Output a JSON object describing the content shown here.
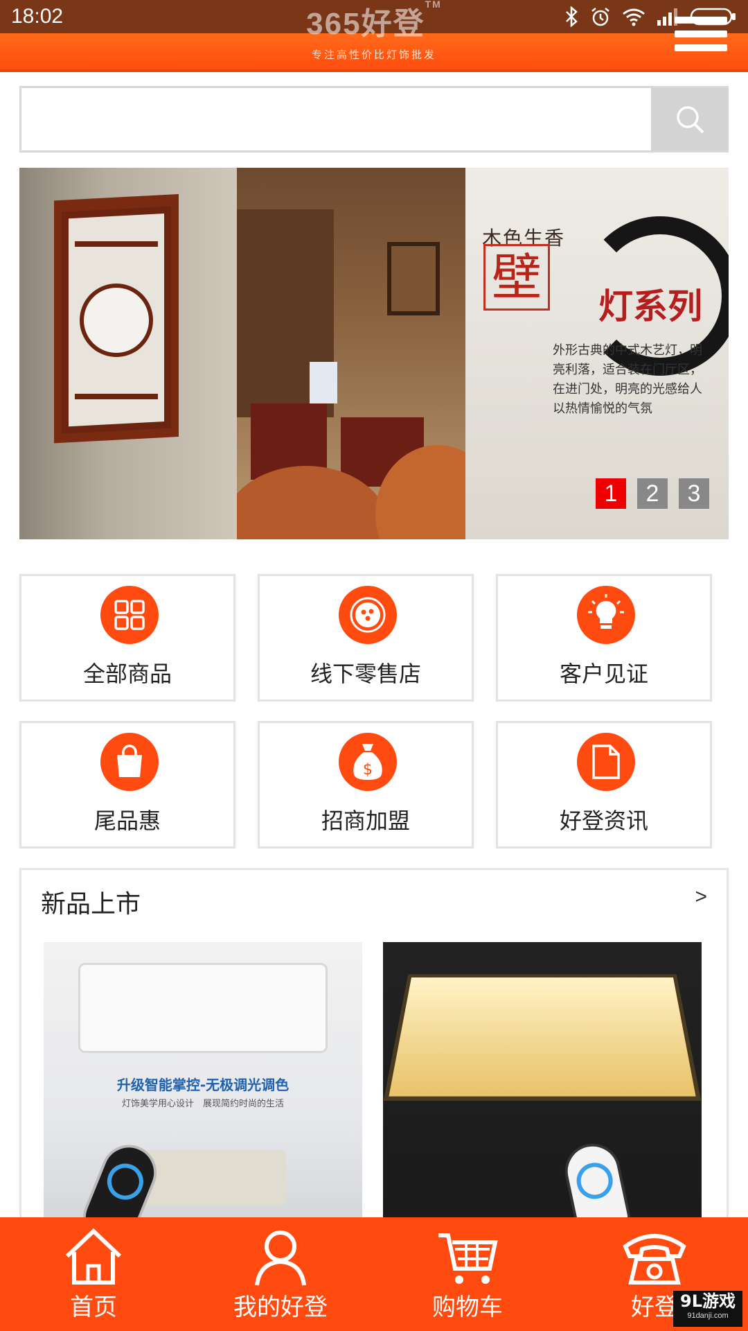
{
  "status_bar": {
    "time": "18:02",
    "icons": [
      "bluetooth-icon",
      "alarm-icon",
      "wifi-icon",
      "signal-icon",
      "battery-icon"
    ]
  },
  "header": {
    "logo_text": "365好登",
    "logo_tm": "TM",
    "logo_subtitle": "专注高性价比灯饰批发"
  },
  "search": {
    "placeholder": "",
    "value": ""
  },
  "banner": {
    "headline": "木色生香",
    "wall_char": "壁",
    "title": "灯系列",
    "description": "外形古典的中式木艺灯，明亮利落，适合装在门厅区，在进门处，明亮的光感给人以热情愉悦的气氛",
    "pages": [
      "1",
      "2",
      "3"
    ],
    "active_page": 0
  },
  "categories": [
    {
      "label": "全部商品",
      "icon": "grid-icon"
    },
    {
      "label": "线下零售店",
      "icon": "store-dots-icon"
    },
    {
      "label": "客户见证",
      "icon": "lightbulb-icon"
    },
    {
      "label": "尾品惠",
      "icon": "shopping-bag-icon"
    },
    {
      "label": "招商加盟",
      "icon": "money-bag-icon"
    },
    {
      "label": "好登资讯",
      "icon": "document-icon"
    }
  ],
  "new_products": {
    "title": "新品上市",
    "more": ">",
    "items": [
      {
        "promo": "升级智能掌控-无极调光调色",
        "promo_sub": "灯饰美学用心设计　展现简约时尚的生活"
      },
      {
        "promo": "",
        "promo_sub": ""
      }
    ]
  },
  "bottom_nav": [
    {
      "label": "首页",
      "icon": "home-icon"
    },
    {
      "label": "我的好登",
      "icon": "user-icon"
    },
    {
      "label": "购物车",
      "icon": "cart-icon"
    },
    {
      "label": "好登",
      "icon": "phone-icon"
    }
  ],
  "watermark": {
    "main": "9L游戏",
    "sub": "91danji.com"
  },
  "colors": {
    "brand_orange": "#ff4a10",
    "status_bar": "#7a3718",
    "active_dot": "#ee0000"
  }
}
